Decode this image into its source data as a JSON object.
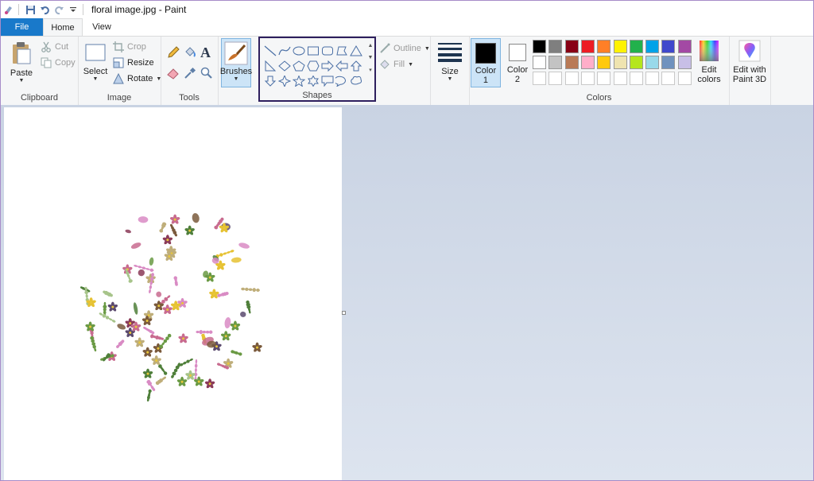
{
  "title": {
    "text": "floral image.jpg - Paint"
  },
  "tabs": {
    "file": "File",
    "home": "Home",
    "view": "View"
  },
  "clipboard": {
    "paste": "Paste",
    "cut": "Cut",
    "copy": "Copy",
    "label": "Clipboard"
  },
  "image": {
    "select": "Select",
    "crop": "Crop",
    "resize": "Resize",
    "rotate": "Rotate",
    "label": "Image"
  },
  "tools": {
    "label": "Tools",
    "text_glyph": "A"
  },
  "brushes": {
    "label": "Brushes"
  },
  "shapes": {
    "label": "Shapes",
    "outline": "Outline",
    "fill": "Fill"
  },
  "size": {
    "label": "Size"
  },
  "colors": {
    "color1_label": "Color\n1",
    "color2_label": "Color\n2",
    "edit_colors": "Edit\ncolors",
    "edit_paint3d": "Edit with\nPaint 3D",
    "label": "Colors",
    "color1": "#000000",
    "color2": "#ffffff",
    "palette_row1": [
      "#000000",
      "#7f7f7f",
      "#880015",
      "#ed1c24",
      "#ff7f27",
      "#fff200",
      "#22b14c",
      "#00a2e8",
      "#3f48cc",
      "#a349a4"
    ],
    "palette_row2": [
      "#ffffff",
      "#c3c3c3",
      "#b97a57",
      "#ffaec9",
      "#ffc90e",
      "#efe4b0",
      "#b5e61d",
      "#99d9ea",
      "#7092be",
      "#c8bfe7"
    ]
  },
  "canvas": {
    "image": "floral arrangement on white background"
  }
}
